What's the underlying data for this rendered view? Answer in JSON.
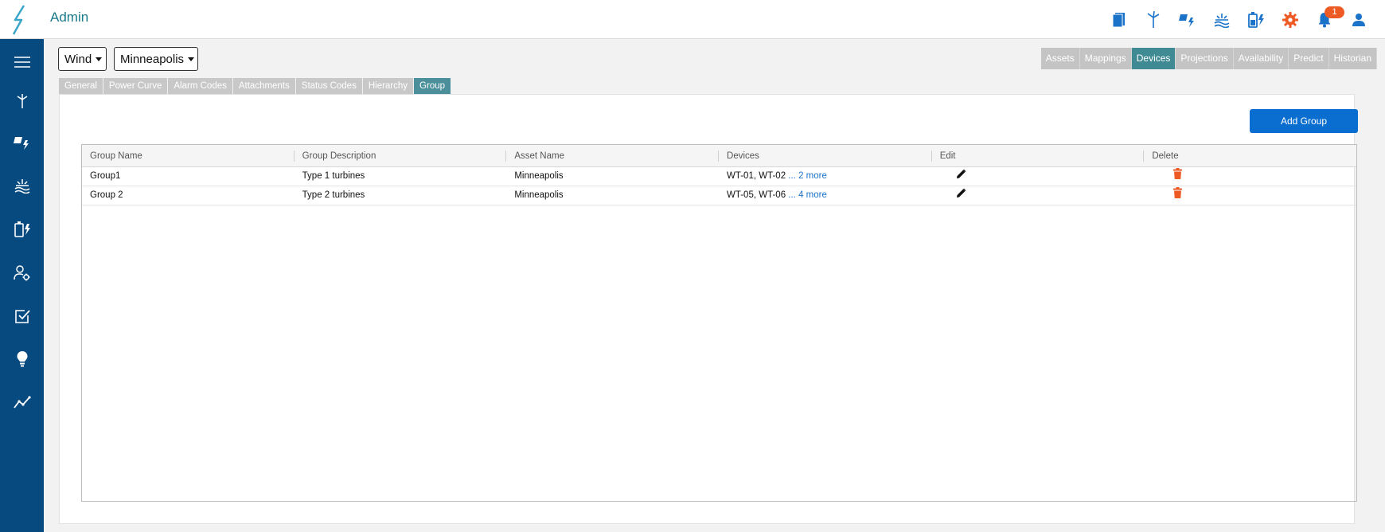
{
  "header": {
    "title": "Admin"
  },
  "notifications": {
    "count": "1"
  },
  "selectors": {
    "energy_type": "Wind",
    "site": "Minneapolis"
  },
  "main_tabs": [
    "Assets",
    "Mappings",
    "Devices",
    "Projections",
    "Availability",
    "Predict",
    "Historian"
  ],
  "sub_tabs": [
    "General",
    "Power Curve",
    "Alarm Codes",
    "Attachments",
    "Status Codes",
    "Hierarchy",
    "Group"
  ],
  "add_button": "Add Group",
  "table": {
    "columns": [
      "Group Name",
      "Group Description",
      "Asset Name",
      "Devices",
      "Edit",
      "Delete"
    ],
    "rows": [
      {
        "name": "Group1",
        "description": "Type 1 turbines",
        "asset": "Minneapolis",
        "devices": "WT-01, WT-02",
        "ellipsis": " ... ",
        "more": "2 more"
      },
      {
        "name": "Group 2",
        "description": "Type 2 turbines",
        "asset": "Minneapolis",
        "devices": "WT-05, WT-06",
        "ellipsis": " ... ",
        "more": "4 more"
      }
    ]
  },
  "colors": {
    "sidebar": "#064a80",
    "accent": "#1a7a8a",
    "active_tab": "#3f8a93",
    "button": "#0a6ed1",
    "delete": "#ee5a24"
  }
}
